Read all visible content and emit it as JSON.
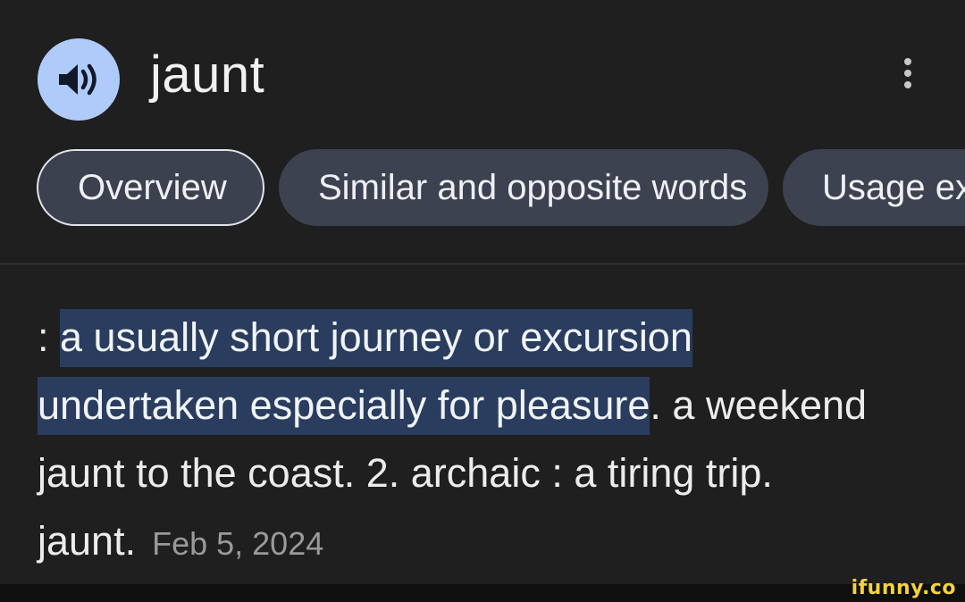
{
  "header": {
    "speaker_icon": "speaker-icon",
    "word": "jaunt",
    "more_icon": "more-vert-icon"
  },
  "tabs": [
    {
      "label": "Overview",
      "active": true
    },
    {
      "label": "Similar and opposite words",
      "active": false
    },
    {
      "label": "Usage ex",
      "active": false
    }
  ],
  "definition": {
    "prefix": ": ",
    "highlighted_line1": "a usually short journey or excursion",
    "highlighted_line2": "undertaken especially for pleasure",
    "rest": ". a weekend jaunt to the coast. 2. archaic : a tiring trip. jaunt.",
    "date": "Feb 5, 2024"
  },
  "watermark": "ifunny.co",
  "colors": {
    "background": "#1f1f1f",
    "speaker_button": "#aecbfa",
    "tab_background": "#3c4250",
    "highlight": "#2a3d5e",
    "watermark": "#f4d23c"
  }
}
